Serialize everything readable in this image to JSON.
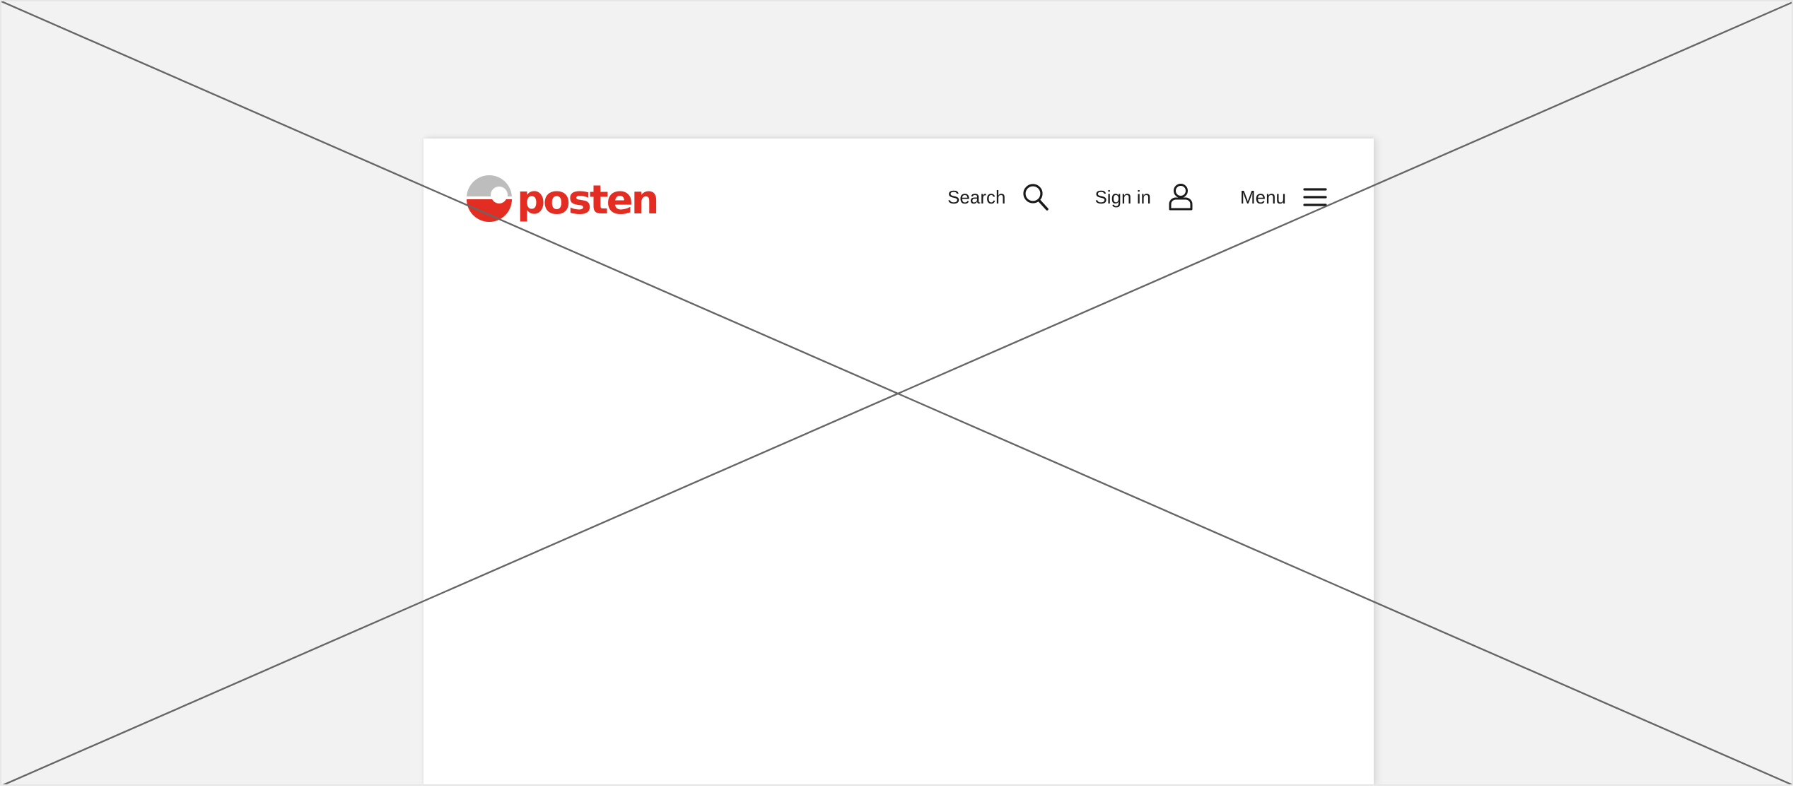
{
  "brand": {
    "name": "posten",
    "color": "#e32d22",
    "mark_gray": "#bdbdbd",
    "logo_icon": "posten-logo-icon"
  },
  "nav": {
    "search": {
      "label": "Search",
      "icon": "search-icon"
    },
    "signin": {
      "label": "Sign in",
      "icon": "user-icon"
    },
    "menu": {
      "label": "Menu",
      "icon": "hamburger-menu-icon"
    }
  },
  "placeholder": {
    "type": "image-placeholder",
    "background": "#f2f2f2",
    "line_color": "#666666"
  }
}
